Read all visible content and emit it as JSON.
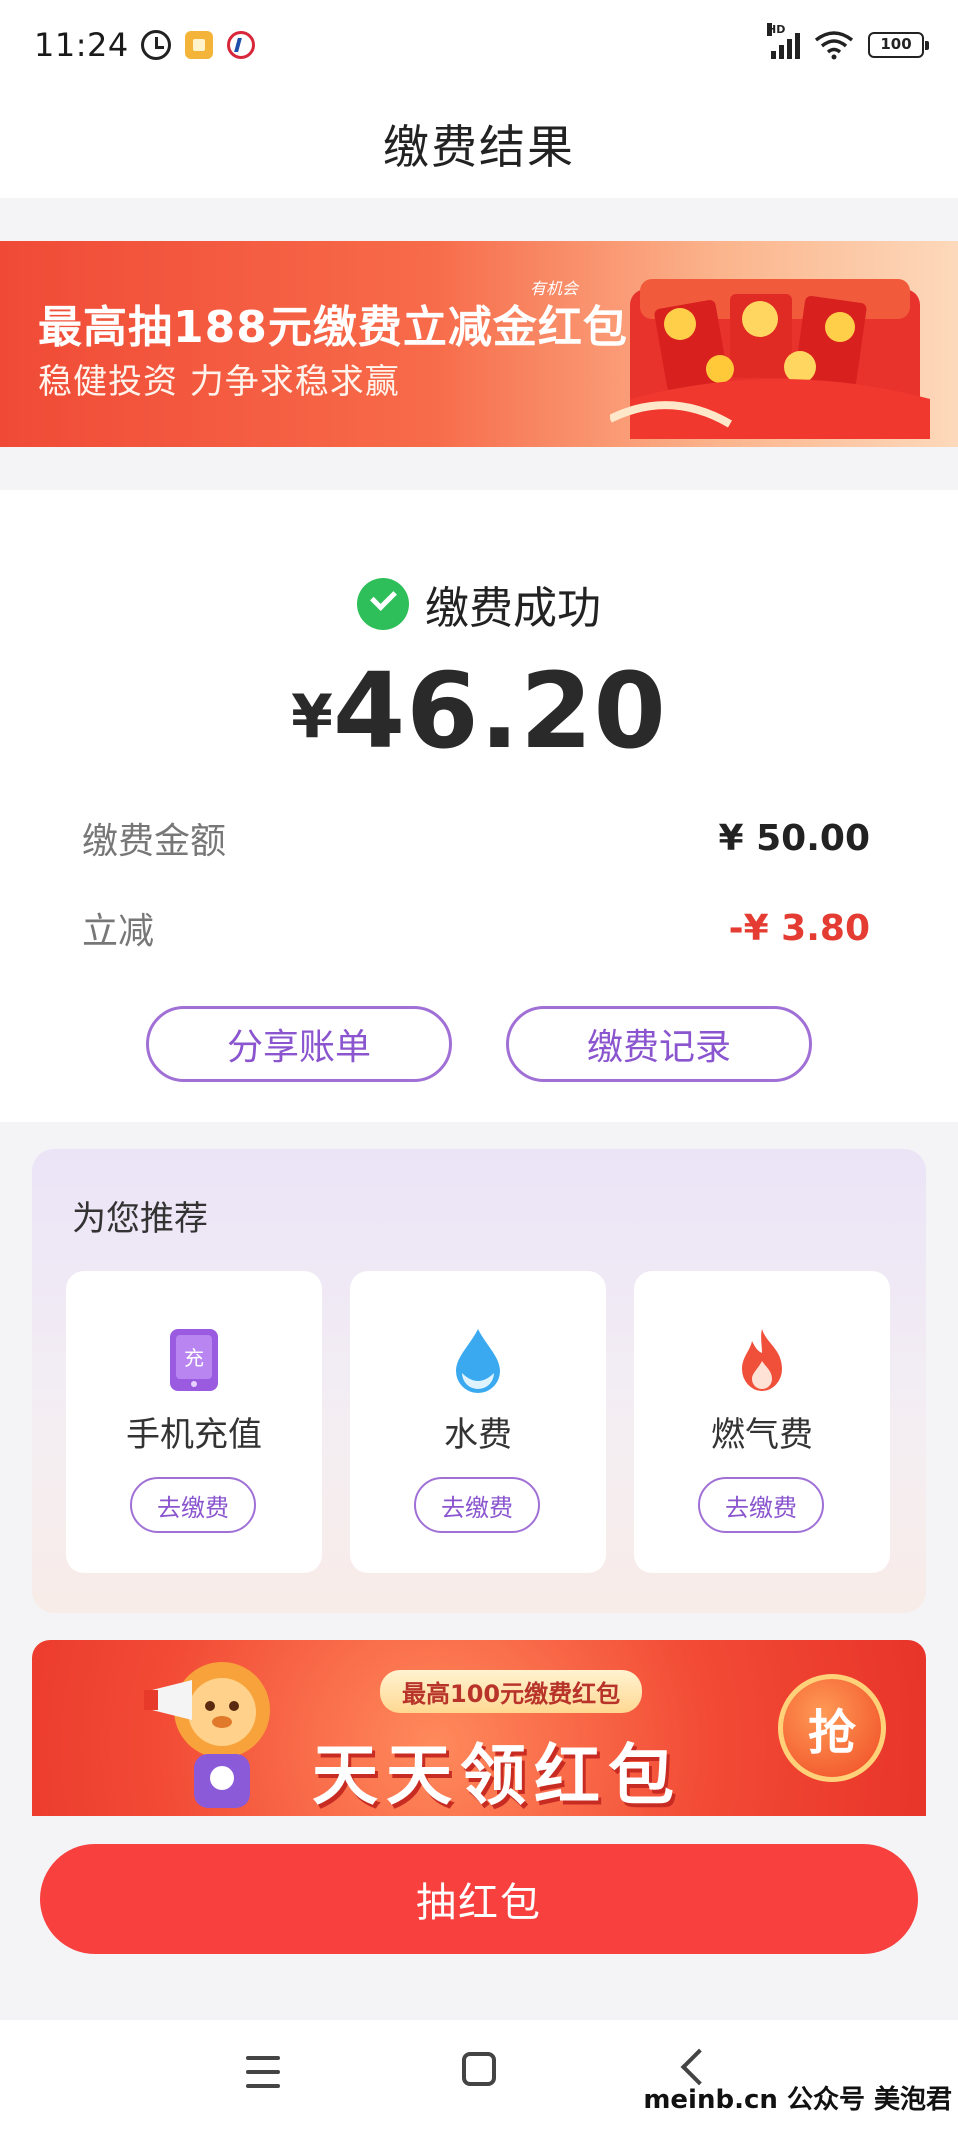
{
  "status_bar": {
    "time": "11:24",
    "network_label": "HD",
    "battery": "100"
  },
  "header": {
    "title": "缴费结果"
  },
  "promo_banner": {
    "title": "最高抽188元缴费立减金红包",
    "subtitle": "稳健投资 力争求稳求赢",
    "tag": "有机会"
  },
  "result": {
    "status": "缴费成功",
    "currency_symbol": "¥",
    "amount": "46.20",
    "details": [
      {
        "label": "缴费金额",
        "value": "¥ 50.00"
      },
      {
        "label": "立减",
        "value": "-¥ 3.80"
      }
    ],
    "share_label": "分享账单",
    "records_label": "缴费记录"
  },
  "recommend": {
    "title": "为您推荐",
    "items": [
      {
        "name": "手机充值",
        "icon": "phone-recharge-icon",
        "button": "去缴费"
      },
      {
        "name": "水费",
        "icon": "water-drop-icon",
        "button": "去缴费"
      },
      {
        "name": "燃气费",
        "icon": "flame-icon",
        "button": "去缴费"
      }
    ]
  },
  "daily_banner": {
    "subtitle": "最高100元缴费红包",
    "title": "天天领红包",
    "grab": "抢"
  },
  "main_button": {
    "label": "抽红包"
  },
  "watermark": "meinb.cn 公众号 美泡君",
  "colors": {
    "accent_purple": "#8a55cf",
    "success_green": "#2fbf5a",
    "discount_red": "#e43c32",
    "button_red": "#f8403f"
  }
}
